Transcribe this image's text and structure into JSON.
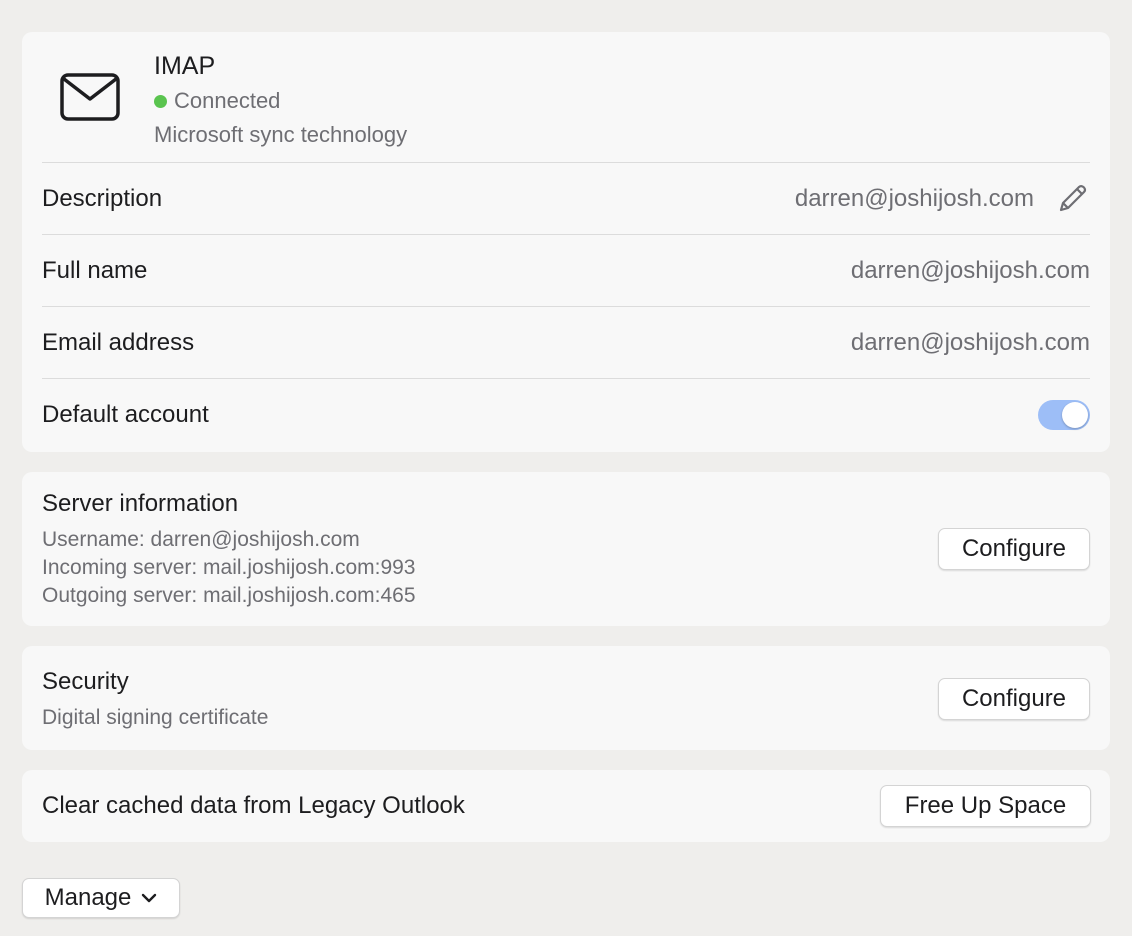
{
  "account": {
    "type": "IMAP",
    "status": "Connected",
    "technology": "Microsoft sync technology",
    "rows": {
      "description": {
        "label": "Description",
        "value": "darren@joshijosh.com"
      },
      "full_name": {
        "label": "Full name",
        "value": "darren@joshijosh.com"
      },
      "email": {
        "label": "Email address",
        "value": "darren@joshijosh.com"
      },
      "default": {
        "label": "Default account",
        "enabled": true
      }
    },
    "icons": {
      "account": "mail-icon",
      "edit": "pencil-icon"
    },
    "colors": {
      "status": "#5ac44f",
      "toggle_on": "#9dbef7"
    }
  },
  "server": {
    "title": "Server information",
    "username": "Username: darren@joshijosh.com",
    "incoming": "Incoming server: mail.joshijosh.com:993",
    "outgoing": "Outgoing server: mail.joshijosh.com:465",
    "button": "Configure"
  },
  "security": {
    "title": "Security",
    "subtitle": "Digital signing certificate",
    "button": "Configure"
  },
  "cache": {
    "label": "Clear cached data from Legacy Outlook",
    "button": "Free Up Space"
  },
  "manage": {
    "label": "Manage",
    "icon": "chevron-down-icon"
  }
}
